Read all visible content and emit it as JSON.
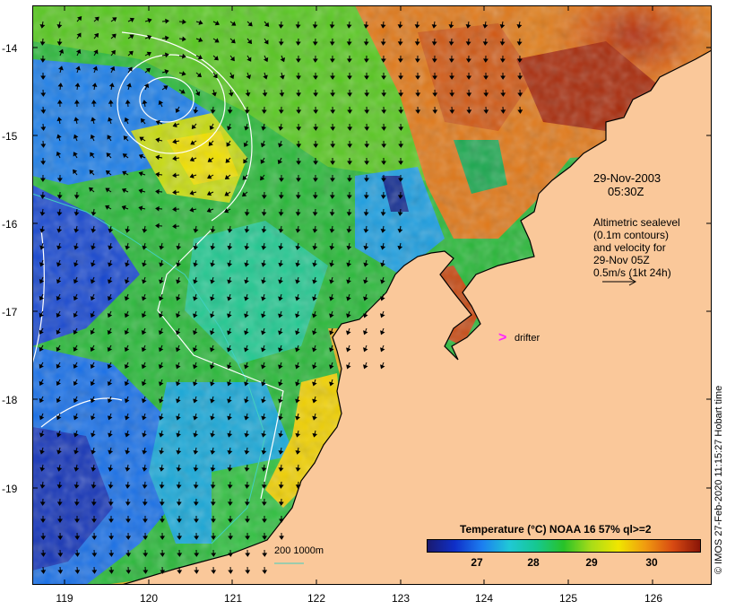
{
  "map": {
    "lat_labels": [
      "-14",
      "-15",
      "-16",
      "-17",
      "-18",
      "-19"
    ],
    "lon_labels": [
      "119",
      "120",
      "121",
      "122",
      "123",
      "124",
      "125",
      "126"
    ]
  },
  "annotations": {
    "date": "29-Nov-2003",
    "time": "05:30Z",
    "legend_line1": "Altimetric sealevel",
    "legend_line2": "(0.1m contours)",
    "legend_line3": "and velocity for",
    "legend_line4": "29-Nov 05Z",
    "legend_line5": "0.5m/s (1kt 24h)",
    "drifter_symbol": ">",
    "drifter_label": "drifter",
    "depth_label": "200  1000m"
  },
  "colorbar": {
    "title": "Temperature (°C) NOAA 16 57% ql>=2",
    "ticks": [
      "27",
      "28",
      "29",
      "30"
    ]
  },
  "credit": "© IMOS 27-Feb-2020 11:15:27 Hobart time",
  "colors": {
    "land": "#fac89a",
    "coast": "#000000",
    "arrows": "#000000",
    "contours": "#ffffff",
    "isobath_200": "#40d0c0",
    "drifter": "#ff20ff"
  }
}
